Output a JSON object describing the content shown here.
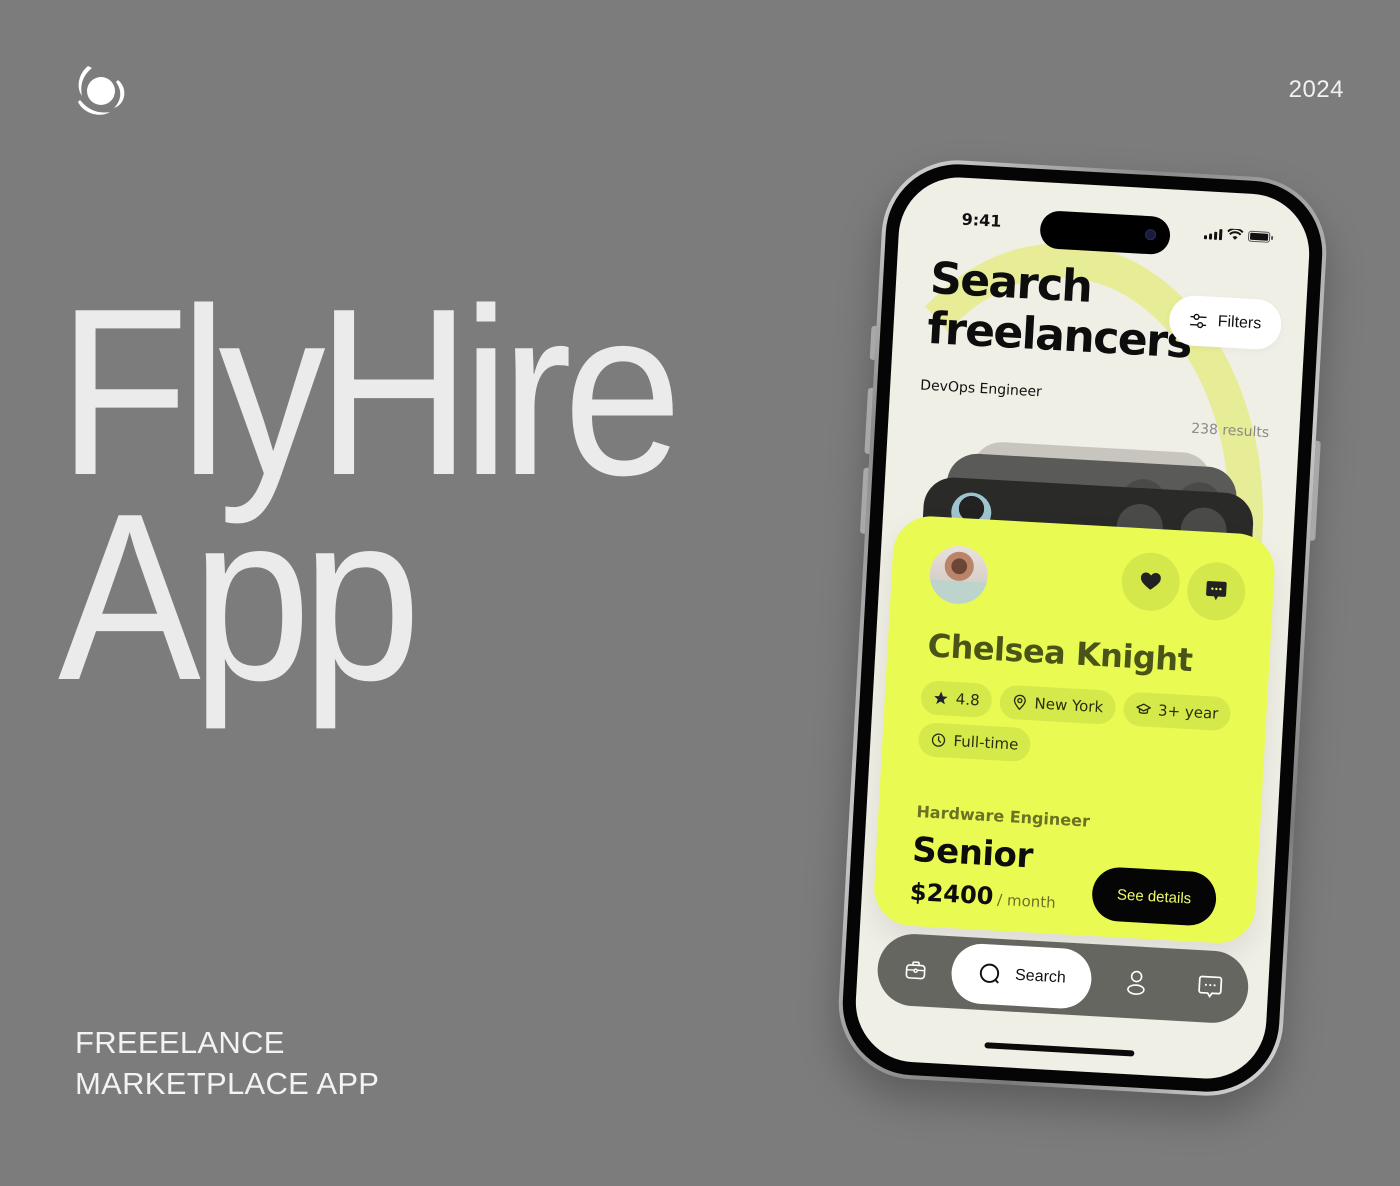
{
  "page": {
    "year": "2024",
    "hero_title": [
      "FlyHire",
      "App"
    ],
    "tagline": [
      "FREEELANCE",
      "MARKETPLACE APP"
    ],
    "logo_icon": "swirl-logo-icon",
    "background_color": "#7c7c7c"
  },
  "phone": {
    "status_bar": {
      "time": "9:41",
      "icons": [
        "cellular-signal-icon",
        "wifi-icon",
        "battery-icon"
      ]
    },
    "header": {
      "title": [
        "Search",
        "freelancers"
      ],
      "filters_label": "Filters",
      "filters_icon": "sliders-icon",
      "subtitle": "DevOps Engineer",
      "results": "238 results"
    },
    "card": {
      "name": "Chelsea Knight",
      "favorite_icon": "heart-icon",
      "message_icon": "chat-bubble-icon",
      "chips": [
        {
          "icon": "star-icon",
          "label": "4.8"
        },
        {
          "icon": "location-pin-icon",
          "label": "New York"
        },
        {
          "icon": "graduation-cap-icon",
          "label": "3+ year"
        },
        {
          "icon": "clock-icon",
          "label": "Full-time"
        }
      ],
      "role": "Hardware Engineer",
      "level": "Senior",
      "price": "$2400",
      "price_unit": "/ month",
      "cta_label": "See details",
      "accent_color": "#e9fb52"
    },
    "tabbar": {
      "items": [
        {
          "icon": "briefcase-icon",
          "label": ""
        },
        {
          "icon": "search-icon",
          "label": "Search",
          "active": true
        },
        {
          "icon": "user-icon",
          "label": ""
        },
        {
          "icon": "chat-bubble-icon",
          "label": ""
        }
      ]
    }
  }
}
